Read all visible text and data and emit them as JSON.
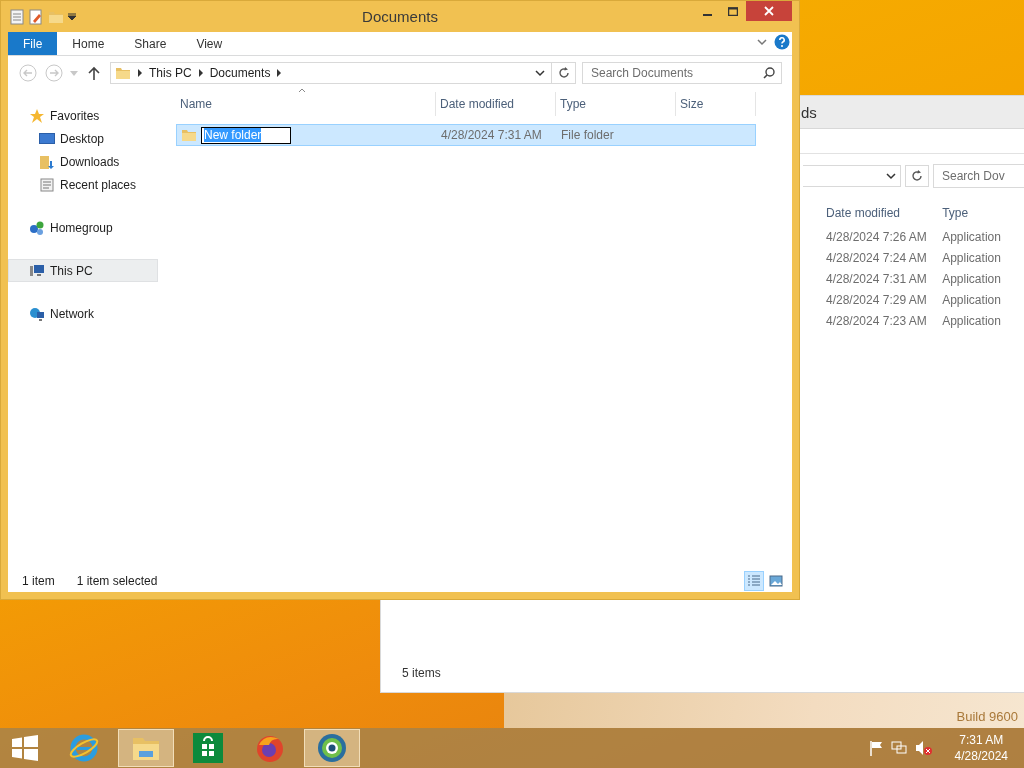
{
  "desktop": {
    "watermark": "Build 9600"
  },
  "back_window": {
    "title": "ds",
    "search": {
      "placeholder": "Search Dov"
    },
    "columns": [
      "Date modified",
      "Type"
    ],
    "rows": [
      {
        "date": "4/28/2024 7:26 AM",
        "type": "Application"
      },
      {
        "date": "4/28/2024 7:24 AM",
        "type": "Application"
      },
      {
        "date": "4/28/2024 7:31 AM",
        "type": "Application"
      },
      {
        "date": "4/28/2024 7:29 AM",
        "type": "Application"
      },
      {
        "date": "4/28/2024 7:23 AM",
        "type": "Application"
      }
    ],
    "status_bar": "5 items"
  },
  "window": {
    "title": "Documents"
  },
  "ribbon_tabs": [
    {
      "label": "File",
      "kind": "file"
    },
    {
      "label": "Home",
      "kind": "tab"
    },
    {
      "label": "Share",
      "kind": "tab"
    },
    {
      "label": "View",
      "kind": "tab"
    }
  ],
  "breadcrumbs": [
    "This PC",
    "Documents"
  ],
  "search": {
    "placeholder": "Search Documents"
  },
  "nav": [
    {
      "label": "Favorites",
      "kind": "star",
      "selected": false,
      "children": [
        {
          "label": "Desktop",
          "kind": "desktop",
          "selected": false
        },
        {
          "label": "Downloads",
          "kind": "downloads",
          "selected": false
        },
        {
          "label": "Recent places",
          "kind": "recent",
          "selected": false
        }
      ]
    },
    {
      "label": "Homegroup",
      "kind": "homegroup",
      "selected": false
    },
    {
      "label": "This PC",
      "kind": "pc",
      "selected": true
    },
    {
      "label": "Network",
      "kind": "network",
      "selected": false
    }
  ],
  "columns": [
    "Name",
    "Date modified",
    "Type",
    "Size"
  ],
  "rows": [
    {
      "name": "New folder",
      "date": "4/28/2024 7:31 AM",
      "type": "File folder",
      "selected": true,
      "renaming": true
    }
  ],
  "status_bar": {
    "count": "1 item",
    "selection": "1 item selected"
  },
  "view_buttons": [
    {
      "kind": "details",
      "selected": true
    },
    {
      "kind": "tiles",
      "selected": false
    }
  ],
  "taskbar": {
    "apps": [
      {
        "kind": "browser",
        "running": false
      },
      {
        "kind": "explorer",
        "running": true
      },
      {
        "kind": "store",
        "running": false
      },
      {
        "kind": "firefox",
        "running": false
      },
      {
        "kind": "globe",
        "running": true
      }
    ],
    "clock": {
      "time": "7:31 AM",
      "date": "4/28/2024"
    }
  }
}
